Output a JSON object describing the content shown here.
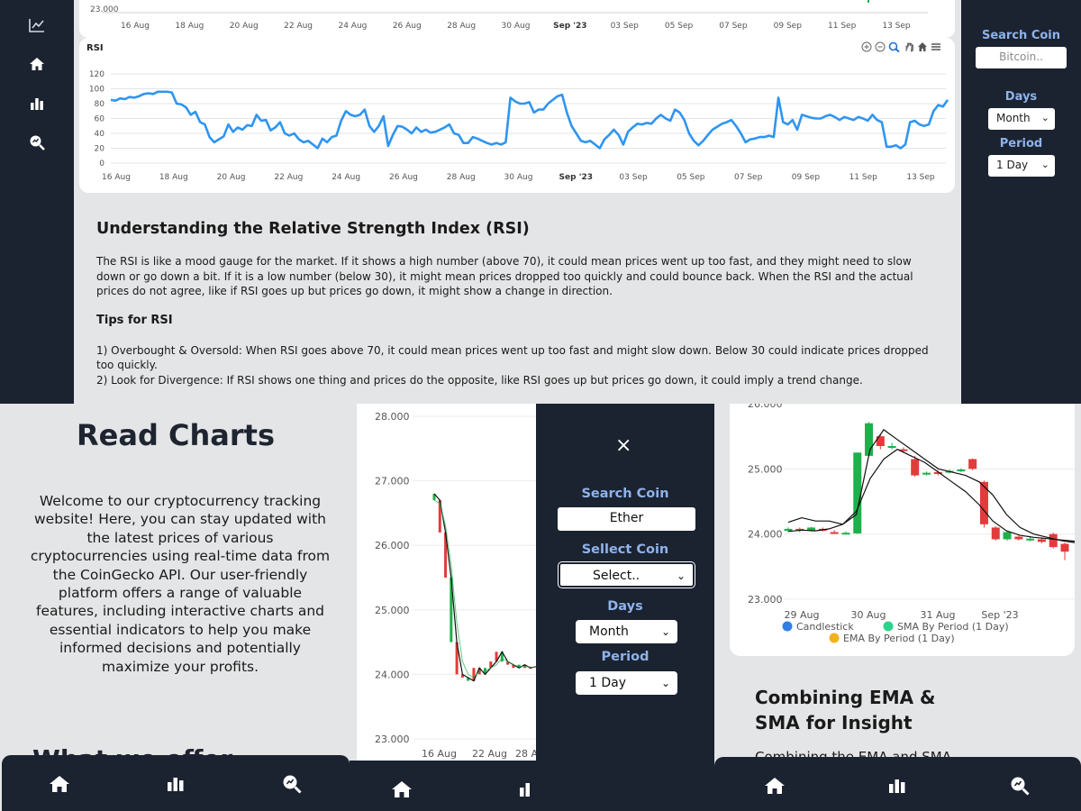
{
  "colors": {
    "dark_navy": "#1b2230",
    "accent_label": "#8fb3ea",
    "rsi_line": "#2f95ef",
    "candle_up": "#1eb04a",
    "candle_down": "#e23b3b",
    "page_bg": "#e4e5e6"
  },
  "top": {
    "nav_icons": [
      "chart-line-icon",
      "home-icon",
      "bar-chart-icon",
      "magnifier-chart-icon"
    ],
    "sidebar": {
      "search_label": "Search Coin",
      "search_placeholder": "Bitcoin..",
      "days_label": "Days",
      "days_value": "Month",
      "period_label": "Period",
      "period_value": "1 Day"
    },
    "price_strip": {
      "y_label": "23.000",
      "x_labels": [
        "16 Aug",
        "18 Aug",
        "20 Aug",
        "22 Aug",
        "24 Aug",
        "26 Aug",
        "28 Aug",
        "30 Aug",
        "Sep '23",
        "03 Sep",
        "05 Sep",
        "07 Sep",
        "09 Sep",
        "11 Sep",
        "13 Sep"
      ]
    },
    "rsi_chart_title": "RSI",
    "toolbar_icons": [
      "zoom-in-icon",
      "zoom-out-icon",
      "zoom-select-icon",
      "pan-hand-icon",
      "reset-home-icon",
      "menu-icon"
    ],
    "article": {
      "title": "Understanding the Relative Strength Index (RSI)",
      "body": "The RSI is like a mood gauge for the market. If it shows a high number (above 70), it could mean prices went up too fast, and they might need to slow down or go down a bit. If it is a low number (below 30), it might mean prices dropped too quickly and could bounce back. When the RSI and the actual prices do not agree, like if RSI goes up but prices go down, it might show a change in direction.",
      "tips_title": "Tips for RSI",
      "tip1": "1) Overbought & Oversold: When RSI goes above 70, it could mean prices went up too fast and might slow down. Below 30 could indicate prices dropped too quickly.",
      "tip2": "2) Look for Divergence: If RSI shows one thing and prices do the opposite, like RSI goes up but prices go down, it could imply a trend change."
    }
  },
  "chart_data": [
    {
      "type": "line",
      "title": "RSI",
      "x_labels": [
        "16 Aug",
        "18 Aug",
        "20 Aug",
        "22 Aug",
        "24 Aug",
        "26 Aug",
        "28 Aug",
        "30 Aug",
        "Sep '23",
        "03 Sep",
        "05 Sep",
        "07 Sep",
        "09 Sep",
        "11 Sep",
        "13 Sep"
      ],
      "y_ticks": [
        0,
        20,
        40,
        60,
        80,
        100,
        120
      ],
      "ylim": [
        0,
        120
      ],
      "grid": true,
      "series": [
        {
          "values": [
            85,
            84,
            87,
            86,
            89,
            88,
            90,
            93,
            94,
            93,
            96,
            96,
            96,
            95,
            80,
            79,
            75,
            65,
            69,
            55,
            52,
            35,
            28,
            32,
            36,
            52,
            42,
            48,
            45,
            51,
            50,
            65,
            57,
            58,
            44,
            48,
            55,
            40,
            37,
            40,
            32,
            28,
            30,
            25,
            20,
            33,
            28,
            35,
            37,
            57,
            70,
            65,
            63,
            65,
            72,
            50,
            42,
            50,
            63,
            23,
            38,
            50,
            49,
            45,
            40,
            48,
            42,
            45,
            41,
            42,
            45,
            48,
            52,
            40,
            38,
            27,
            27,
            35,
            33,
            30,
            27,
            25,
            27,
            25,
            28,
            88,
            83,
            80,
            80,
            82,
            68,
            72,
            72,
            80,
            85,
            90,
            92,
            68,
            50,
            40,
            30,
            28,
            30,
            25,
            20,
            32,
            38,
            45,
            38,
            25,
            42,
            48,
            53,
            52,
            54,
            53,
            60,
            65,
            60,
            57,
            72,
            68,
            58,
            40,
            30,
            24,
            30,
            38,
            45,
            49,
            53,
            55,
            58,
            50,
            40,
            28,
            32,
            33,
            35,
            35,
            37,
            35,
            88,
            55,
            52,
            58,
            45,
            65,
            63,
            61,
            60,
            60,
            63,
            65,
            62,
            58,
            62,
            60,
            58,
            62,
            60,
            57,
            65,
            58,
            55,
            22,
            22,
            24,
            20,
            25,
            55,
            57,
            52,
            50,
            52,
            70,
            78,
            76,
            85
          ]
        }
      ]
    },
    {
      "type": "line",
      "y_ticks": [
        "23.000",
        "24.000",
        "25.000",
        "26.000",
        "27.000",
        "28.000"
      ],
      "ylim": [
        23000,
        28000
      ],
      "x_labels": [
        "16 Aug",
        "22 Aug",
        "28 A"
      ],
      "series": [
        {
          "values": [
            26800,
            26700,
            26200,
            25500,
            24500,
            24000,
            23950,
            23900,
            24100,
            24000,
            24100,
            24200,
            24350,
            24200,
            24150,
            24100,
            24150,
            24100,
            24120
          ]
        },
        {
          "values": [
            26700,
            26650,
            26300,
            25700,
            24800,
            24200,
            24000,
            23950,
            24050,
            24050,
            24100,
            24150,
            24250,
            24200,
            24150,
            24120,
            24130,
            24110,
            24115
          ]
        }
      ]
    },
    {
      "type": "candlestick",
      "y_ticks": [
        "23.000",
        "24.000",
        "25.000",
        "26.000"
      ],
      "ylim": [
        23000,
        26000
      ],
      "x_labels": [
        "29 Aug",
        "30 Aug",
        "31 Aug",
        "Sep '23"
      ],
      "legend": [
        "Candlestick",
        "SMA By Period (1 Day)",
        "EMA By Period (1 Day)"
      ],
      "legend_colors": [
        "#2f7fe6",
        "#2ed38a",
        "#f3b21b"
      ],
      "series": [
        {
          "name": "SMA By Period (1 Day)",
          "values": [
            24180,
            24250,
            24200,
            24200,
            24150,
            24300,
            25300,
            25600,
            25450,
            25300,
            25150,
            25000,
            24950,
            24900,
            24800,
            24600,
            24300,
            24100,
            24000,
            23950,
            23900,
            23870
          ]
        },
        {
          "name": "EMA By Period (1 Day)",
          "values": [
            24040,
            24060,
            24050,
            24080,
            24150,
            24350,
            24850,
            25150,
            25300,
            25200,
            25100,
            24950,
            24800,
            24650,
            24450,
            24200,
            24050,
            23980,
            23950,
            23930,
            23910,
            23890
          ]
        }
      ],
      "candles": [
        {
          "o": 24050,
          "c": 24080,
          "h": 24100,
          "l": 24030
        },
        {
          "o": 24080,
          "c": 24050,
          "h": 24100,
          "l": 24030
        },
        {
          "o": 24050,
          "c": 24100,
          "h": 24110,
          "l": 24040
        },
        {
          "o": 24080,
          "c": 24050,
          "h": 24100,
          "l": 24040
        },
        {
          "o": 24030,
          "c": 24010,
          "h": 24060,
          "l": 24000
        },
        {
          "o": 24010,
          "c": 24020,
          "h": 24040,
          "l": 24000
        },
        {
          "o": 24010,
          "c": 25250,
          "h": 25250,
          "l": 24000
        },
        {
          "o": 25200,
          "c": 25700,
          "h": 25720,
          "l": 25200
        },
        {
          "o": 25500,
          "c": 25350,
          "h": 25520,
          "l": 25300
        },
        {
          "o": 25350,
          "c": 25350,
          "h": 25400,
          "l": 25300
        },
        {
          "o": 25300,
          "c": 25280,
          "h": 25330,
          "l": 25250
        },
        {
          "o": 25150,
          "c": 24900,
          "h": 25200,
          "l": 24880
        },
        {
          "o": 24920,
          "c": 24940,
          "h": 24960,
          "l": 24900
        },
        {
          "o": 24950,
          "c": 24930,
          "h": 24980,
          "l": 24900
        },
        {
          "o": 24950,
          "c": 24970,
          "h": 24990,
          "l": 24930
        },
        {
          "o": 24970,
          "c": 24990,
          "h": 25010,
          "l": 24950
        },
        {
          "o": 25150,
          "c": 25000,
          "h": 25160,
          "l": 24980
        },
        {
          "o": 24800,
          "c": 24150,
          "h": 24820,
          "l": 24100
        },
        {
          "o": 24100,
          "c": 23920,
          "h": 24120,
          "l": 23900
        },
        {
          "o": 23920,
          "c": 24030,
          "h": 24050,
          "l": 23900
        },
        {
          "o": 23960,
          "c": 23920,
          "h": 23980,
          "l": 23900
        },
        {
          "o": 23920,
          "c": 23930,
          "h": 23960,
          "l": 23890
        },
        {
          "o": 23920,
          "c": 23880,
          "h": 23950,
          "l": 23860
        },
        {
          "o": 24000,
          "c": 23800,
          "h": 24020,
          "l": 23780
        },
        {
          "o": 23850,
          "c": 23730,
          "h": 23870,
          "l": 23600
        }
      ]
    }
  ],
  "read_charts": {
    "title": "Read Charts",
    "welcome": "Welcome to our cryptocurrency tracking website! Here, you can stay updated with the latest prices of various cryptocurrencies using real-time data from the CoinGecko API. Our user-friendly platform offers a range of valuable features, including interactive charts and essential indicators to help you make informed decisions and potentially maximize your profits.",
    "cut_heading": "What we offer"
  },
  "mobile_menu": {
    "close": "×",
    "search_label": "Search Coin",
    "search_value": "Ether",
    "select_coin_label": "Sellect Coin",
    "select_value": "Select..",
    "days_label": "Days",
    "days_value": "Month",
    "period_label": "Period",
    "period_value": "1 Day"
  },
  "ema": {
    "title_line1": "Combining EMA &",
    "title_line2": "SMA for Insight",
    "cut_text": "Combining the EMA and SMA"
  },
  "bottom_bar_icons": [
    "home-icon",
    "bar-chart-icon",
    "magnifier-chart-icon"
  ]
}
